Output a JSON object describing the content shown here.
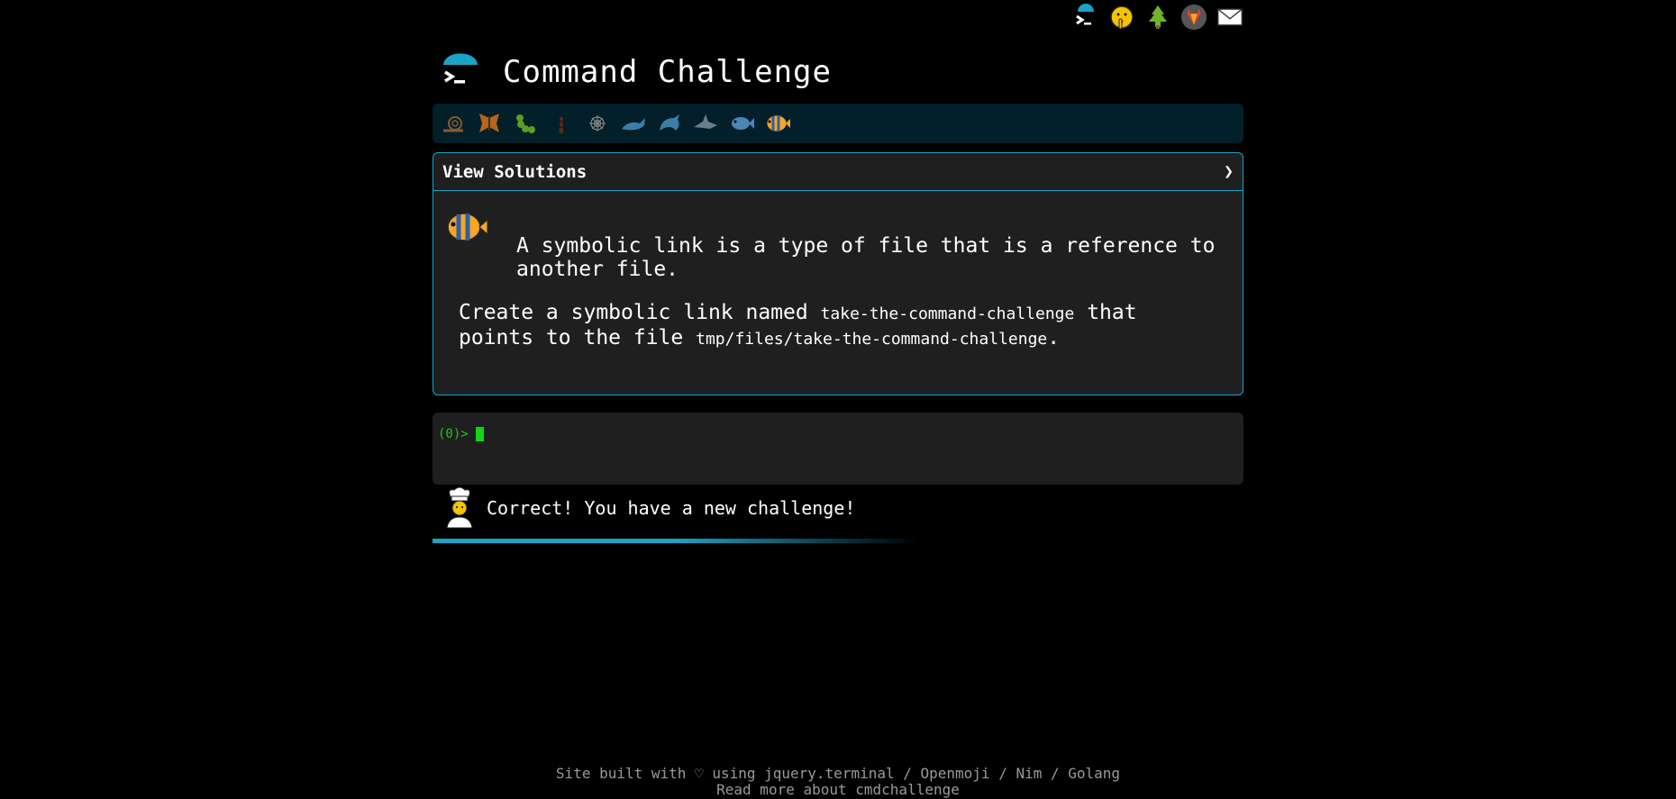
{
  "app": {
    "title": "Command Challenge"
  },
  "top_icons": [
    "terminal-icon",
    "shushing-face-icon",
    "tree-icon",
    "gitlab-icon",
    "mail-icon"
  ],
  "levels": [
    {
      "name": "snail",
      "icon": "snail-icon"
    },
    {
      "name": "butterfly",
      "icon": "butterfly-icon"
    },
    {
      "name": "caterpillar",
      "icon": "caterpillar-icon"
    },
    {
      "name": "ant",
      "icon": "ant-icon"
    },
    {
      "name": "spider",
      "icon": "spider-icon"
    },
    {
      "name": "whale",
      "icon": "whale-icon"
    },
    {
      "name": "dolphin",
      "icon": "dolphin-icon"
    },
    {
      "name": "shark",
      "icon": "shark-icon"
    },
    {
      "name": "fish",
      "icon": "fish-icon"
    },
    {
      "name": "tropical-fish",
      "icon": "tropical-fish-icon"
    }
  ],
  "solutions": {
    "label": "View Solutions",
    "chevron": "❯"
  },
  "challenge": {
    "description": "A symbolic link is a type of file that is a reference to another file.",
    "task_prefix": "Create a symbolic link named ",
    "code1": "take-the-command-challenge",
    "task_middle": " that points to the file ",
    "code2": "tmp/files/take-the-command-challenge",
    "task_suffix": "."
  },
  "terminal": {
    "prompt": "(0)>"
  },
  "message": {
    "text": "Correct! You have a new challenge!"
  },
  "footer": {
    "line1": "Site built with ♡ using jquery.terminal / Openmoji / Nim / Golang",
    "line2": "Read more about cmdchallenge"
  },
  "colors": {
    "accent": "#1aa3c7",
    "prompt": "#22c322",
    "cursor": "#11d611",
    "background": "#000000",
    "panel": "#1f1f1f"
  }
}
